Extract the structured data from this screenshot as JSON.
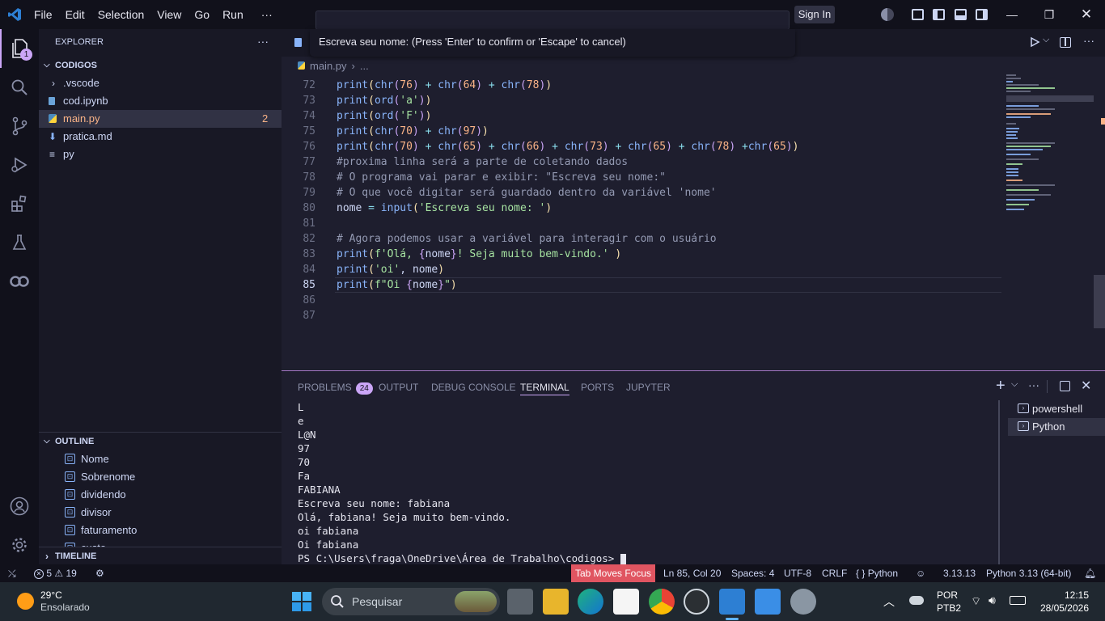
{
  "titlebar": {
    "menus": [
      "File",
      "Edit",
      "Selection",
      "View",
      "Go",
      "Run",
      "···"
    ],
    "sign_in": "Sign In",
    "input_prompt": "Escreva seu nome: (Press 'Enter' to confirm or 'Escape' to cancel)"
  },
  "activity": {
    "explorer_badge": "1"
  },
  "sidebar": {
    "title": "EXPLORER",
    "more": "···",
    "folder": "CODIGOS",
    "items": [
      {
        "label": ".vscode",
        "badge": ""
      },
      {
        "label": "cod.ipynb",
        "badge": ""
      },
      {
        "label": "main.py",
        "badge": "2"
      },
      {
        "label": "pratica.md",
        "badge": ""
      },
      {
        "label": "py",
        "badge": ""
      }
    ],
    "outline_title": "OUTLINE",
    "outline": [
      "Nome",
      "Sobrenome",
      "dividendo",
      "divisor",
      "faturamento",
      "custo"
    ],
    "timeline_title": "TIMELINE"
  },
  "editor": {
    "breadcrumb_file": "main.py",
    "breadcrumb_more": "...",
    "lines": [
      {
        "n": "72",
        "text": "print(chr(76) + chr(64) + chr(78))"
      },
      {
        "n": "73",
        "text": "print(ord('a'))"
      },
      {
        "n": "74",
        "text": "print(ord('F'))"
      },
      {
        "n": "75",
        "text": "print(chr(70) + chr(97))"
      },
      {
        "n": "76",
        "text": "print(chr(70) + chr(65) + chr(66) + chr(73) + chr(65) + chr(78) +chr(65))"
      },
      {
        "n": "77",
        "text": "#proxima linha será a parte de coletando dados"
      },
      {
        "n": "78",
        "text": "# O programa vai parar e exibir: \"Escreva seu nome:\""
      },
      {
        "n": "79",
        "text": "# O que você digitar será guardado dentro da variável 'nome'"
      },
      {
        "n": "80",
        "text": "nome = input('Escreva seu nome: ')"
      },
      {
        "n": "81",
        "text": ""
      },
      {
        "n": "82",
        "text": "# Agora podemos usar a variável para interagir com o usuário"
      },
      {
        "n": "83",
        "text": "print(f'Olá, {nome}! Seja muito bem-vindo.' )"
      },
      {
        "n": "84",
        "text": "print('oi', nome)"
      },
      {
        "n": "85",
        "text": "print(f\"Oi {nome}\")"
      },
      {
        "n": "86",
        "text": ""
      },
      {
        "n": "87",
        "text": ""
      }
    ]
  },
  "panel": {
    "tabs": [
      "PROBLEMS",
      "OUTPUT",
      "DEBUG CONSOLE",
      "TERMINAL",
      "PORTS",
      "JUPYTER"
    ],
    "problems_count": "24",
    "terminal_output": [
      "L",
      "e",
      "L@N",
      "97",
      "70",
      "Fa",
      "FABIANA",
      "Escreva seu nome: fabiana",
      "Olá, fabiana! Seja muito bem-vindo.",
      "oi fabiana",
      "Oi fabiana",
      "PS C:\\Users\\fraga\\OneDrive\\Área de Trabalho\\codigos> "
    ],
    "terminals": [
      "powershell",
      "Python"
    ]
  },
  "statusbar": {
    "errors": "5",
    "warnings": "19",
    "tab_moves_focus": "Tab Moves Focus",
    "position": "Ln 85, Col 20",
    "spaces": "Spaces: 4",
    "encoding": "UTF-8",
    "eol": "CRLF",
    "language": "Python",
    "py_version": "3.13.13",
    "interpreter": "Python 3.13 (64-bit)"
  },
  "taskbar": {
    "temperature": "29°C",
    "weather": "Ensolarado",
    "search_placeholder": "Pesquisar",
    "lang_line1": "POR",
    "lang_line2": "PTB2",
    "time": "12:15",
    "date": "28/05/2026"
  },
  "colors": {
    "accent": "#a276c2",
    "status_highlight": "#e05561",
    "vscode_blue": "#2d7fd3"
  }
}
